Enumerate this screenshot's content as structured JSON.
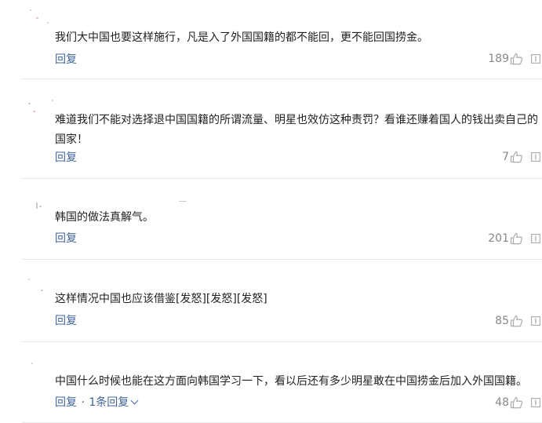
{
  "comments": [
    {
      "text": "我们大中国也要这样施行，凡是入了外国国籍的都不能回，更不能回国捞金。",
      "reply_label": "回复",
      "likes": "189"
    },
    {
      "text": "难道我们不能对选择退中国国籍的所谓流量、明星也效仿这种责罚？看谁还赚着国人的钱出卖自己的国家！",
      "reply_label": "回复",
      "likes": "7"
    },
    {
      "text": "韩国的做法真解气。",
      "reply_label": "回复",
      "likes": "201"
    },
    {
      "text": "这样情况中国也应该借鉴[发怒][发怒][发怒]",
      "reply_label": "回复",
      "likes": "85"
    },
    {
      "text": "中国什么时候也能在这方面向韩国学习一下，看以后还有多少明星敢在中国捞金后加入外国国籍。",
      "reply_label": "回复",
      "separator": "·",
      "replies_label": "1条回复",
      "likes": "48"
    }
  ],
  "icons": {
    "like": "thumbs-up-icon",
    "report": "report-icon",
    "expand": "chevron-down-icon"
  },
  "colors": {
    "link": "#406599",
    "muted": "#888888",
    "divider": "#e8e8e8"
  }
}
